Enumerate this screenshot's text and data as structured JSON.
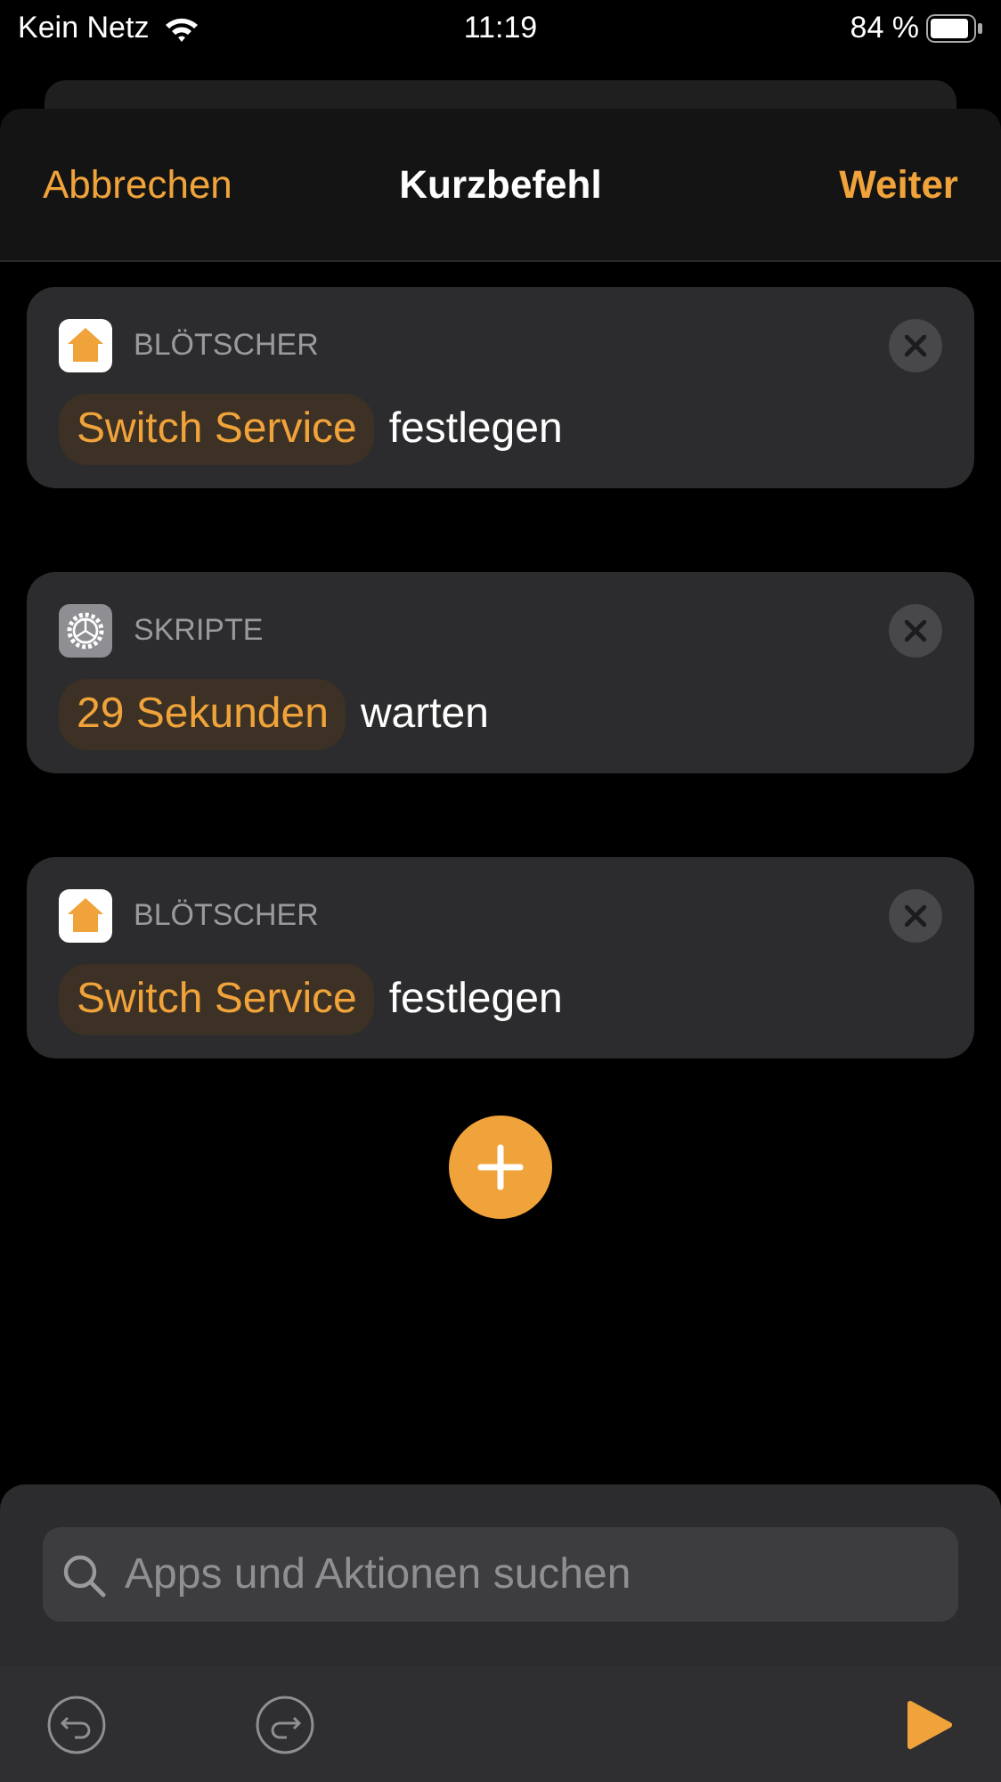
{
  "status_bar": {
    "carrier": "Kein Netz",
    "time": "11:19",
    "battery": "84 %"
  },
  "header": {
    "cancel": "Abbrechen",
    "title": "Kurzbefehl",
    "next": "Weiter"
  },
  "actions": [
    {
      "kind": "home",
      "app": "BLÖTSCHER",
      "parameter": "Switch Service",
      "verb": "festlegen"
    },
    {
      "kind": "scripts",
      "app": "SKRIPTE",
      "parameter": "29 Sekunden",
      "verb": "warten"
    },
    {
      "kind": "home",
      "app": "BLÖTSCHER",
      "parameter": "Switch Service",
      "verb": "festlegen"
    }
  ],
  "search": {
    "placeholder": "Apps und Aktionen suchen"
  }
}
